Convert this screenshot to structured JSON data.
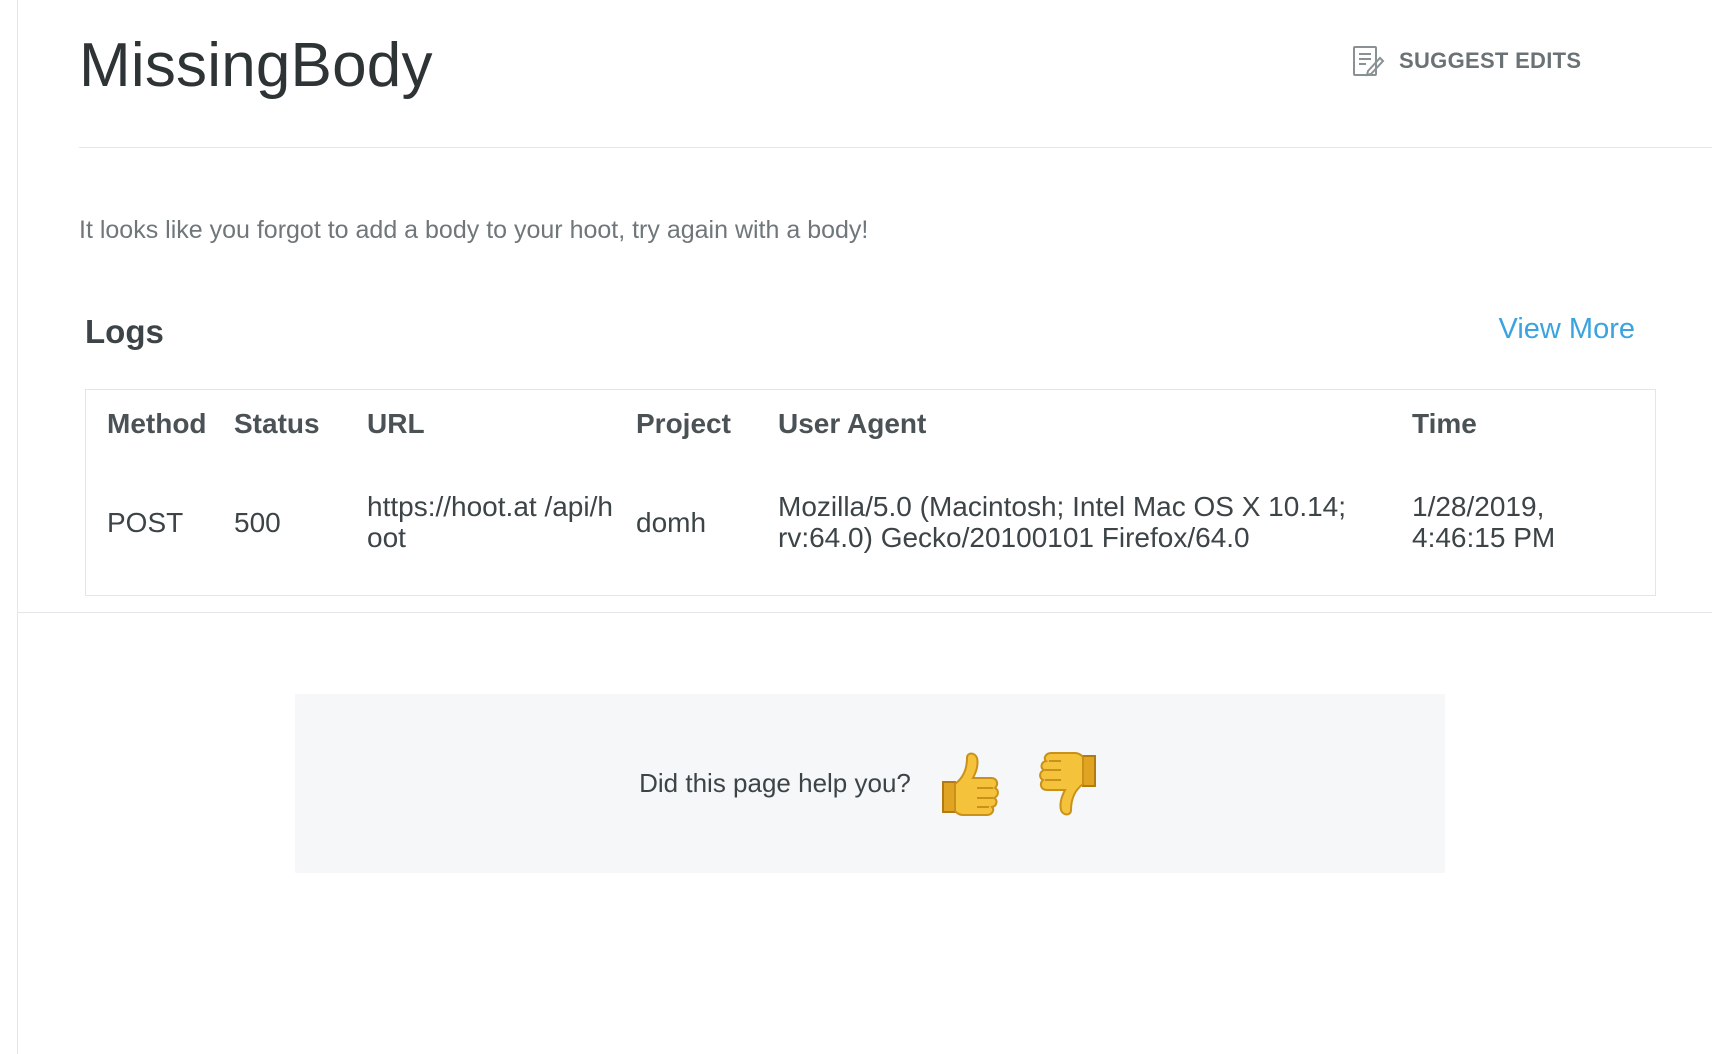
{
  "header": {
    "title": "MissingBody",
    "suggest_edits_label": "SUGGEST EDITS"
  },
  "description": "It looks like you forgot to add a body to your hoot, try again with a body!",
  "logs": {
    "title": "Logs",
    "view_more": "View More",
    "columns": [
      "Method",
      "Status",
      "URL",
      "Project",
      "User Agent",
      "Time"
    ],
    "rows": [
      {
        "method": "POST",
        "status": "500",
        "url": "https://hoot.at /api/hoot",
        "project": "domh",
        "user_agent": "Mozilla/5.0 (Macintosh; Intel Mac OS X 10.14; rv:64.0) Gecko/20100101 Firefox/64.0",
        "time": "1/28/2019, 4:46:15 PM"
      }
    ]
  },
  "feedback": {
    "question": "Did this page help you?",
    "icons": [
      "thumbs-up-icon",
      "thumbs-down-icon"
    ]
  },
  "colors": {
    "link": "#3aa3e0",
    "thumb": "#f5c33b"
  }
}
